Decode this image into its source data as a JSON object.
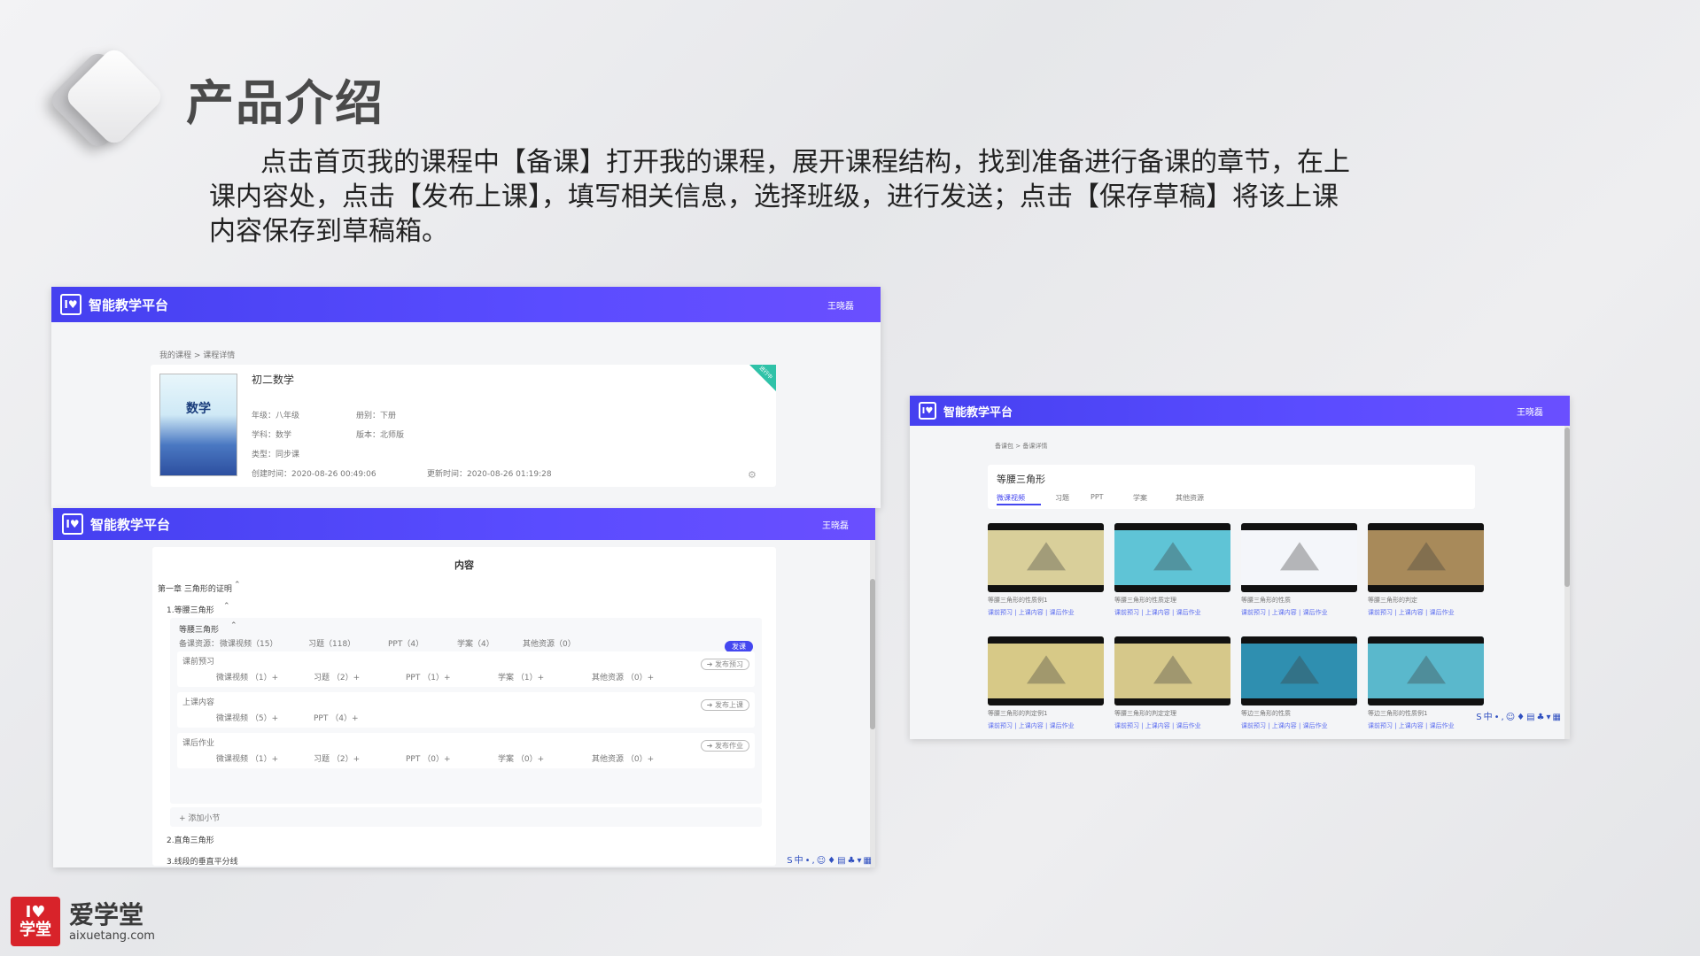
{
  "slide": {
    "title": "产品介绍",
    "intro_lines": [
      "点击首页我的课程中【备课】打开我的课程，展开课程结构，找到准备进行备课的章节，在上",
      "课内容处，点击【发布上课】，填写相关信息，选择班级，进行发送；点击【保存草稿】将该上课",
      "内容保存到草稿箱。"
    ]
  },
  "app": {
    "logo_glyph": "I♥\n学堂",
    "platform_name": "智能教学平台",
    "username": "王晓磊"
  },
  "course_detail": {
    "breadcrumb": "我的课程 > 课程详情",
    "course_name": "初二数学",
    "book_cover_title": "数学",
    "ribbon_text": "进行中",
    "fields": {
      "grade": "年级：八年级",
      "volume": "册别：下册",
      "subject": "学科：数学",
      "edition": "版本：北师版",
      "type": "类型：同步课",
      "created": "创建时间：2020-08-26 00:49:06",
      "updated": "更新时间：2020-08-26 01:19:28"
    }
  },
  "content_panel": {
    "header": "内容",
    "chapter": "第一章 三角形的证明",
    "section1": "1.等腰三角形",
    "subsection": "等腰三角形",
    "resources_label": "备课资源：",
    "resources": [
      "微课视频（15）",
      "习题（118）",
      "PPT（4）",
      "学案（4）",
      "其他资源（0）"
    ],
    "publish_pill": "发课",
    "groups": [
      {
        "title": "课前预习",
        "items": [
          "微课视频 （1）+",
          "习题 （2）+",
          "PPT （1）+",
          "学案 （1）+",
          "其他资源 （0）+"
        ],
        "action": "➔ 发布预习"
      },
      {
        "title": "上课内容",
        "items": [
          "微课视频 （5）+",
          "PPT （4）+"
        ],
        "action": "➔ 发布上课"
      },
      {
        "title": "课后作业",
        "items": [
          "微课视频 （1）+",
          "习题 （2）+",
          "PPT （0）+",
          "学案 （0）+",
          "其他资源 （0）+"
        ],
        "action": "➔ 发布作业"
      }
    ],
    "add_subsection": "+ 添加小节",
    "section2": "2.直角三角形",
    "section3": "3.线段的垂直平分线"
  },
  "video_list": {
    "breadcrumb": "备课包 > 备课详情",
    "topic": "等腰三角形",
    "tabs": [
      "微课视频",
      "习题",
      "PPT",
      "学案",
      "其他资源"
    ],
    "active_tab": "微课视频",
    "videos": [
      {
        "caption": "等腰三角形的性质例1",
        "bg": "#d9cf9a"
      },
      {
        "caption": "等腰三角形的性质定理",
        "bg": "#5fc4d6"
      },
      {
        "caption": "等腰三角形的性质",
        "bg": "#f4f6fa"
      },
      {
        "caption": "等腰三角形的判定",
        "bg": "#a88a5a"
      },
      {
        "caption": "等腰三角形的判定例1",
        "bg": "#d7c987"
      },
      {
        "caption": "等腰三角形的判定定理",
        "bg": "#d6c88a"
      },
      {
        "caption": "等边三角形的性质",
        "bg": "#2f8fb0"
      },
      {
        "caption": "等边三角形的性质例1",
        "bg": "#5ab8cc"
      }
    ],
    "actions": "课前预习 | 上课内容 | 课后作业"
  },
  "toolbar_icons": "S中•,☺♦▤♣▾▦",
  "brand": {
    "badge_top": "I♥",
    "badge_bottom": "学堂",
    "name": "爱学堂",
    "url": "aixuetang.com"
  }
}
